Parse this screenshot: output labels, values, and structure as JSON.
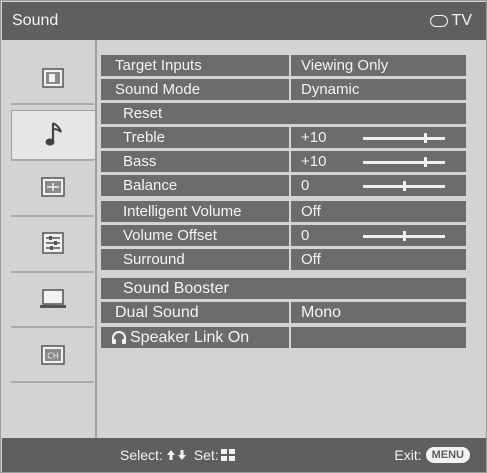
{
  "header": {
    "title": "Sound",
    "badge": "TV"
  },
  "sidebar": {
    "items": [
      {
        "icon": "picture-icon",
        "selected": false
      },
      {
        "icon": "music-note-icon",
        "selected": true
      },
      {
        "icon": "screen-icon",
        "selected": false
      },
      {
        "icon": "setup-icon",
        "selected": false
      },
      {
        "icon": "pc-icon",
        "selected": false
      },
      {
        "icon": "channel-icon",
        "selected": false
      }
    ]
  },
  "menu": {
    "target_inputs": {
      "label": "Target Inputs",
      "value": "Viewing Only"
    },
    "sound_mode": {
      "label": "Sound Mode",
      "value": "Dynamic"
    },
    "reset": {
      "label": "Reset"
    },
    "treble": {
      "label": "Treble",
      "value": "+10",
      "level": 10
    },
    "bass": {
      "label": "Bass",
      "value": "+10",
      "level": 10
    },
    "balance": {
      "label": "Balance",
      "value": "0",
      "level": 0
    },
    "intelligent_volume": {
      "label": "Intelligent Volume",
      "value": "Off"
    },
    "volume_offset": {
      "label": "Volume Offset",
      "value": "0",
      "level": 0
    },
    "surround": {
      "label": "Surround",
      "value": "Off"
    },
    "sound_booster": {
      "label": "Sound Booster"
    },
    "dual_sound": {
      "label": "Dual Sound",
      "value": "Mono"
    },
    "speaker_link": {
      "label": "Speaker Link On",
      "icon": "headphones-icon"
    }
  },
  "footer": {
    "select_label": "Select:",
    "set_label": "Set:",
    "exit_label": "Exit:",
    "exit_key": "MENU"
  },
  "colors": {
    "bar": "#5f5f5f",
    "row": "#6c6c6c",
    "panel": "#d3d3d3",
    "text": "#f4f4f4"
  }
}
